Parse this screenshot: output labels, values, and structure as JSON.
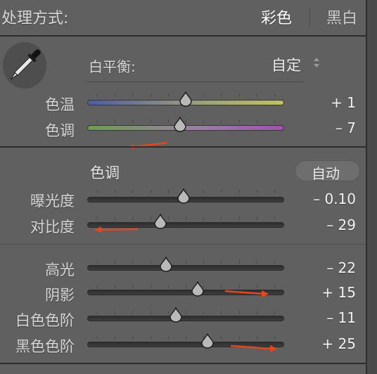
{
  "treatment": {
    "label": "处理方式:",
    "options": [
      "彩色",
      "黑白"
    ],
    "selected": "彩色"
  },
  "white_balance": {
    "label": "白平衡:",
    "value": "自定"
  },
  "wb_sliders": [
    {
      "label": "色温",
      "value": "+ 1",
      "level": 0.5
    },
    {
      "label": "色调",
      "value": "– 7",
      "level": 0.47
    }
  ],
  "tone": {
    "title": "色调",
    "auto_label": "自动",
    "sliders": [
      {
        "label": "曝光度",
        "value": "– 0.10",
        "level": 0.49
      },
      {
        "label": "对比度",
        "value": "– 29",
        "level": 0.37
      }
    ]
  },
  "presence_sliders": [
    {
      "label": "高光",
      "value": "– 22",
      "level": 0.4
    },
    {
      "label": "阴影",
      "value": "+ 15",
      "level": 0.56
    },
    {
      "label": "白色色阶",
      "value": "– 11",
      "level": 0.45
    },
    {
      "label": "黑色色阶",
      "value": "+ 25",
      "level": 0.61
    }
  ],
  "annotation_color": "#e2471e",
  "icons": [
    "eyedropper-icon",
    "updown-arrows-icon",
    "slider-thumb-icon"
  ]
}
